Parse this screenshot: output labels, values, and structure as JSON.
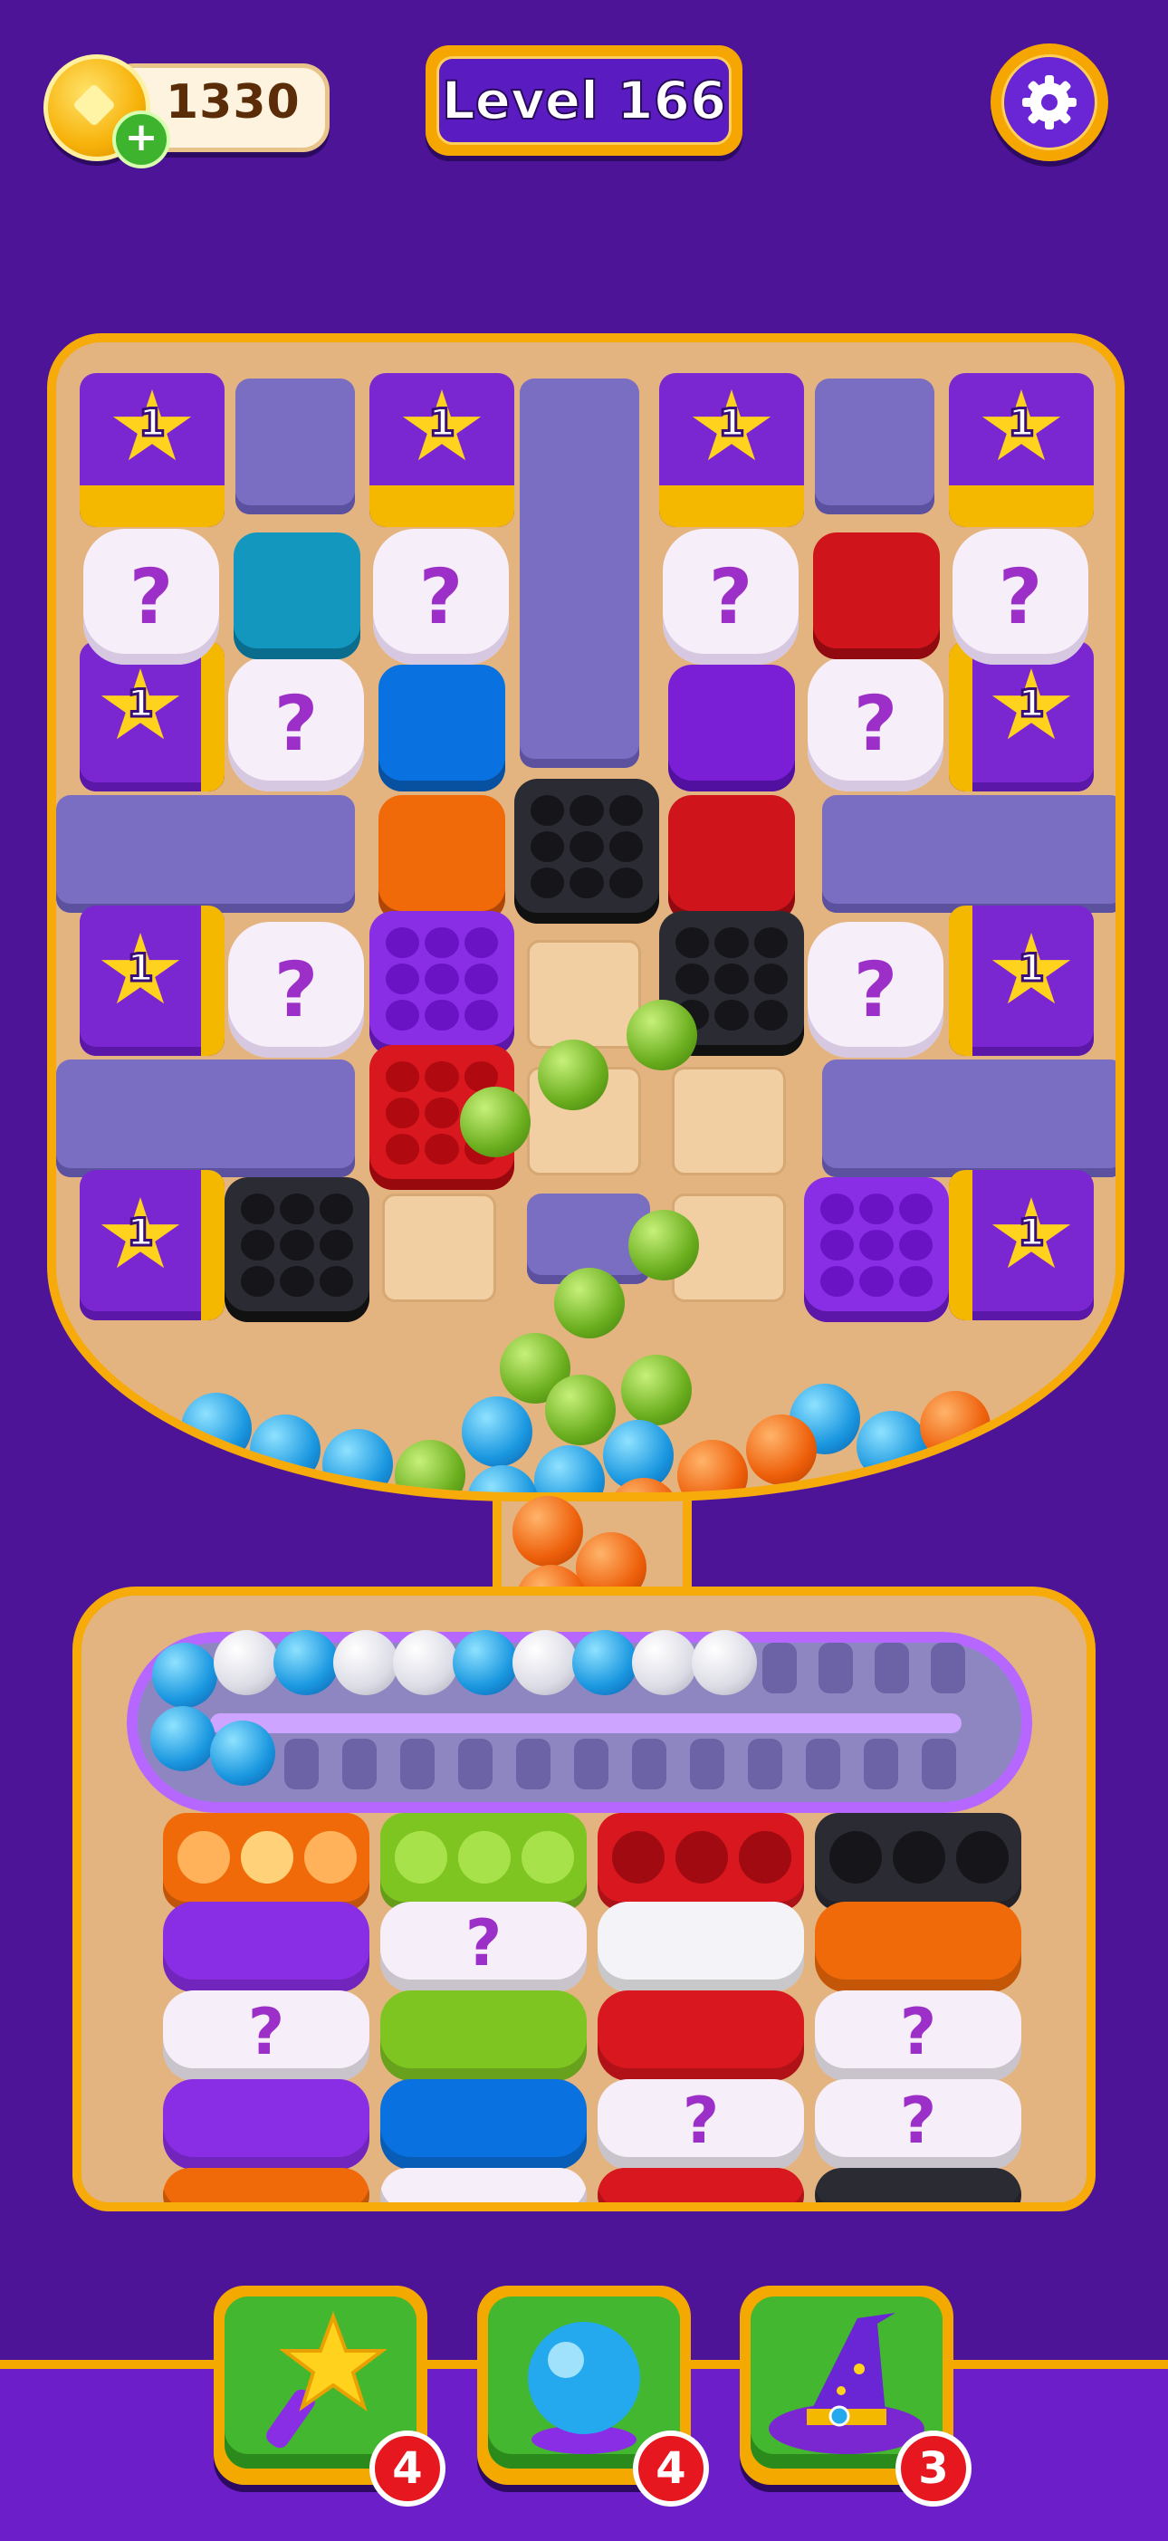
{
  "header": {
    "coins": "1330",
    "level": "Level 166"
  },
  "icons": {
    "coin": "gold-diamond-coin",
    "add_coins": "plus",
    "settings": "gear",
    "booster_1": "magic-wand",
    "booster_2": "crystal-ball",
    "booster_3": "wizard-hat"
  },
  "board": {
    "star_label": "1",
    "mystery_label": "?"
  },
  "containers": {
    "mystery_label": "?"
  },
  "boosters": [
    {
      "name": "magic-wand",
      "count": "4"
    },
    {
      "name": "crystal-ball",
      "count": "4"
    },
    {
      "name": "wizard-hat",
      "count": "3"
    }
  ],
  "colors": {
    "background": "#4d1497",
    "frame": "#f7ab0a",
    "board": "#e3b47f",
    "green": "#6aae1e",
    "blue": "#1a97e0",
    "orange": "#ee5f0a",
    "purple": "#7b27d1",
    "red": "#d8171e",
    "black": "#2b2b33"
  }
}
